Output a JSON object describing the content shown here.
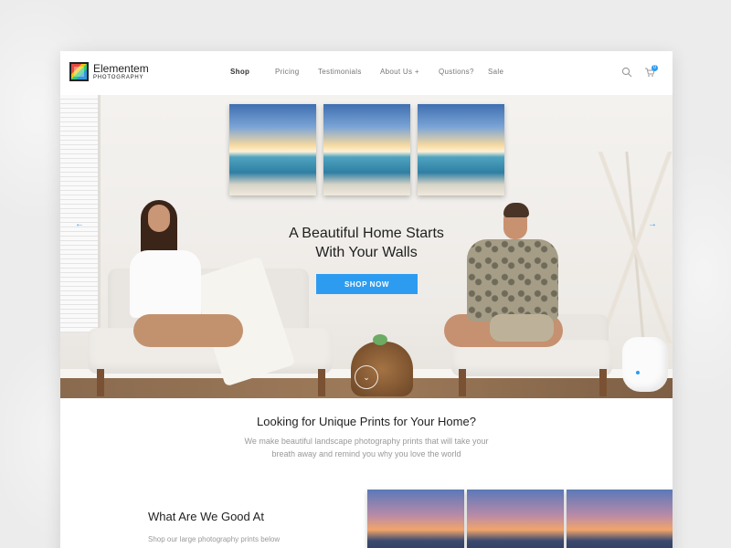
{
  "brand": {
    "name": "Elementem",
    "sub": "PHOTOGRAPHY"
  },
  "nav": {
    "items": [
      {
        "label": "Shop"
      },
      {
        "label": "Pricing"
      },
      {
        "label": "Testimonials"
      },
      {
        "label": "About Us +"
      },
      {
        "label": "Qustions?"
      },
      {
        "label": "Sale"
      }
    ],
    "cart_count": "0"
  },
  "hero": {
    "title_line1": "A Beautiful Home Starts",
    "title_line2": "With Your Walls",
    "cta": "SHOP NOW",
    "arrow_left": "←",
    "arrow_right": "→",
    "scroll_icon": "⌄"
  },
  "intro": {
    "title": "Looking for Unique Prints for Your Home?",
    "text_line1": "We make beautiful landscape photography prints that will take your",
    "text_line2": "breath away and remind you why you love the world"
  },
  "good_at": {
    "title": "What Are We Good At",
    "subtitle": "Shop our large photography prints below"
  },
  "colors": {
    "accent": "#2d9cf0",
    "background": "#ececec",
    "text": "#222222"
  },
  "icons": [
    "logo-mark-icon",
    "search-icon",
    "cart-icon",
    "arrow-left-icon",
    "arrow-right-icon",
    "chevron-down-icon"
  ]
}
